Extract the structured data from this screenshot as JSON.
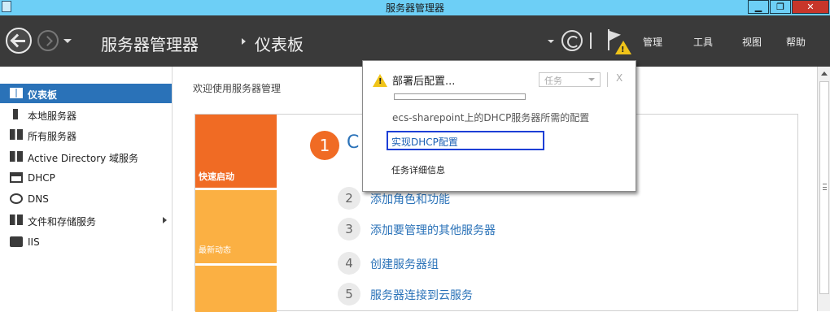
{
  "window": {
    "title": "服务器管理器",
    "min_label": "▁",
    "max_label": "❐",
    "close_label": "✕"
  },
  "header": {
    "app_name": "服务器管理器",
    "page": "仪表板",
    "menu": {
      "manage": "管理",
      "tools": "工具",
      "view": "视图",
      "help": "帮助"
    }
  },
  "sidebar": {
    "items": [
      {
        "label": "仪表板",
        "icon": "dashboard-icon"
      },
      {
        "label": "本地服务器",
        "icon": "server-icon"
      },
      {
        "label": "所有服务器",
        "icon": "servers-icon"
      },
      {
        "label": "Active Directory 域服务",
        "icon": "active-directory-icon"
      },
      {
        "label": "DHCP",
        "icon": "dhcp-icon"
      },
      {
        "label": "DNS",
        "icon": "dns-icon"
      },
      {
        "label": "文件和存储服务",
        "icon": "storage-icon"
      },
      {
        "label": "IIS",
        "icon": "iis-icon"
      }
    ]
  },
  "main": {
    "welcome": "欢迎使用服务器管理",
    "tiles": {
      "quick_start": "快速启动",
      "news": "最新动态"
    },
    "step1": {
      "num": "1",
      "title": "C"
    },
    "steps": [
      {
        "num": "2",
        "label": "添加角色和功能"
      },
      {
        "num": "3",
        "label": "添加要管理的其他服务器"
      },
      {
        "num": "4",
        "label": "创建服务器组"
      },
      {
        "num": "5",
        "label": "服务器连接到云服务"
      }
    ]
  },
  "popup": {
    "title": "部署后配置...",
    "task_select": "任务",
    "close": "X",
    "description": "ecs-sharepoint上的DHCP服务器所需的配置",
    "link": "实现DHCP配置",
    "detail": "任务详细信息"
  },
  "colors": {
    "accent": "#2a72b8",
    "quick_start": "#f06b24",
    "news": "#fbb043",
    "titlebar": "#6dcff6",
    "header": "#3a3a3a"
  }
}
